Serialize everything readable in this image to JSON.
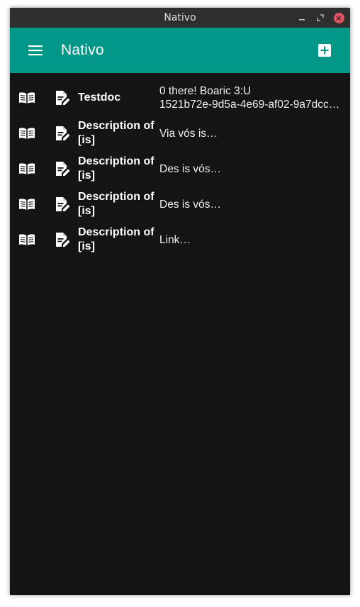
{
  "window": {
    "title": "Nativo",
    "controls": {
      "minimize_icon": "minimize-icon",
      "maximize_icon": "maximize-icon",
      "close_icon": "close-icon"
    }
  },
  "appbar": {
    "title": "Nativo",
    "color": "#009688",
    "menu_icon": "menu-icon",
    "add_icon": "add-box-icon"
  },
  "documents": [
    {
      "title": "Testdoc",
      "description_line1": "0 there! Boaric 3:U",
      "description_line2": "1521b72e-9d5a-4e69-af02-9a7dcc…"
    },
    {
      "title": "Description of [is]",
      "description_line1": "Via vós is…",
      "description_line2": ""
    },
    {
      "title": "Description of [is]",
      "description_line1": "Des is vós…",
      "description_line2": ""
    },
    {
      "title": "Description of [is]",
      "description_line1": "Des is vós…",
      "description_line2": ""
    },
    {
      "title": "Description of [is]",
      "description_line1": "Link…",
      "description_line2": ""
    }
  ],
  "icons": {
    "read": "book-open-icon",
    "edit": "edit-document-icon"
  }
}
